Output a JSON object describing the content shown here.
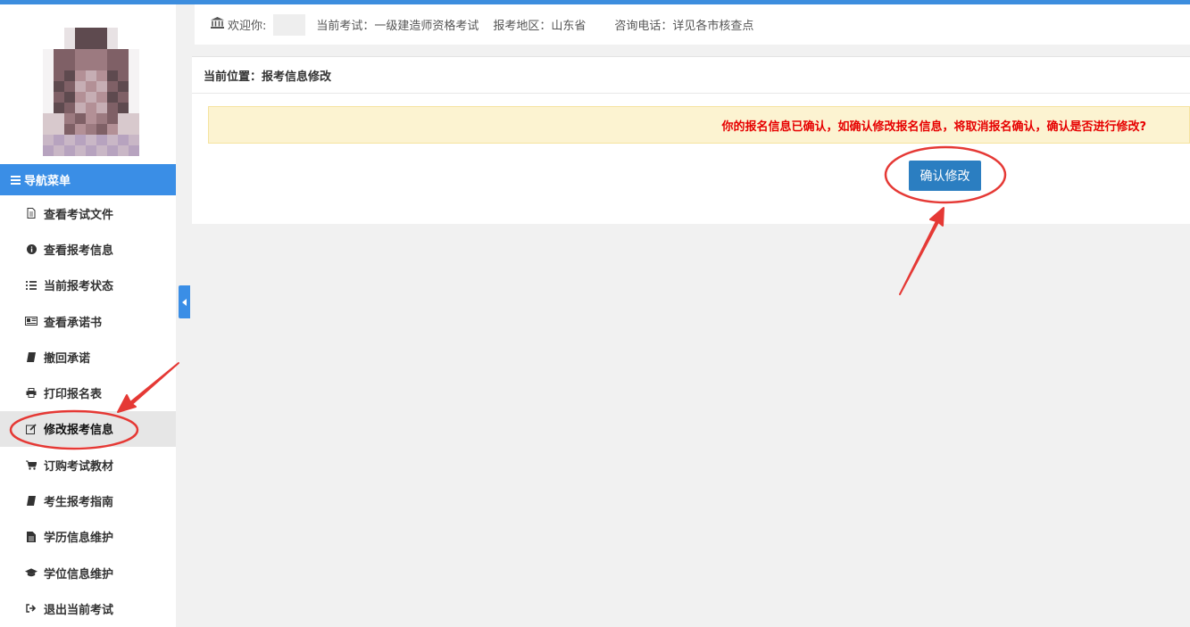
{
  "header": {
    "welcome_label": "欢迎你:",
    "exam": "当前考试：一级建造师资格考试",
    "region": "报考地区：山东省",
    "phone": "咨询电话：详见各市核查点"
  },
  "sidebar": {
    "nav_title": "导航菜单",
    "items": [
      {
        "label": "查看考试文件",
        "icon": "file-icon"
      },
      {
        "label": "查看报考信息",
        "icon": "info-circle-icon"
      },
      {
        "label": "当前报考状态",
        "icon": "list-icon"
      },
      {
        "label": "查看承诺书",
        "icon": "newspaper-icon"
      },
      {
        "label": "撤回承诺",
        "icon": "book-icon"
      },
      {
        "label": "打印报名表",
        "icon": "print-icon"
      },
      {
        "label": "修改报考信息",
        "icon": "edit-icon",
        "active": true
      },
      {
        "label": "订购考试教材",
        "icon": "cart-icon"
      },
      {
        "label": "考生报考指南",
        "icon": "book-icon"
      },
      {
        "label": "学历信息维护",
        "icon": "document-icon"
      },
      {
        "label": "学位信息维护",
        "icon": "graduation-cap-icon"
      },
      {
        "label": "退出当前考试",
        "icon": "sign-out-icon"
      }
    ]
  },
  "main": {
    "breadcrumb": "当前位置：报考信息修改",
    "alert": "你的报名信息已确认，如确认修改报名信息，将取消报名确认，确认是否进行修改?",
    "confirm_button": "确认修改"
  },
  "colors": {
    "accent": "#3a8ee6",
    "alert_bg": "#fcf3d1",
    "alert_text": "#e60000",
    "button": "#2b7ec1",
    "annotation": "#e53935"
  }
}
